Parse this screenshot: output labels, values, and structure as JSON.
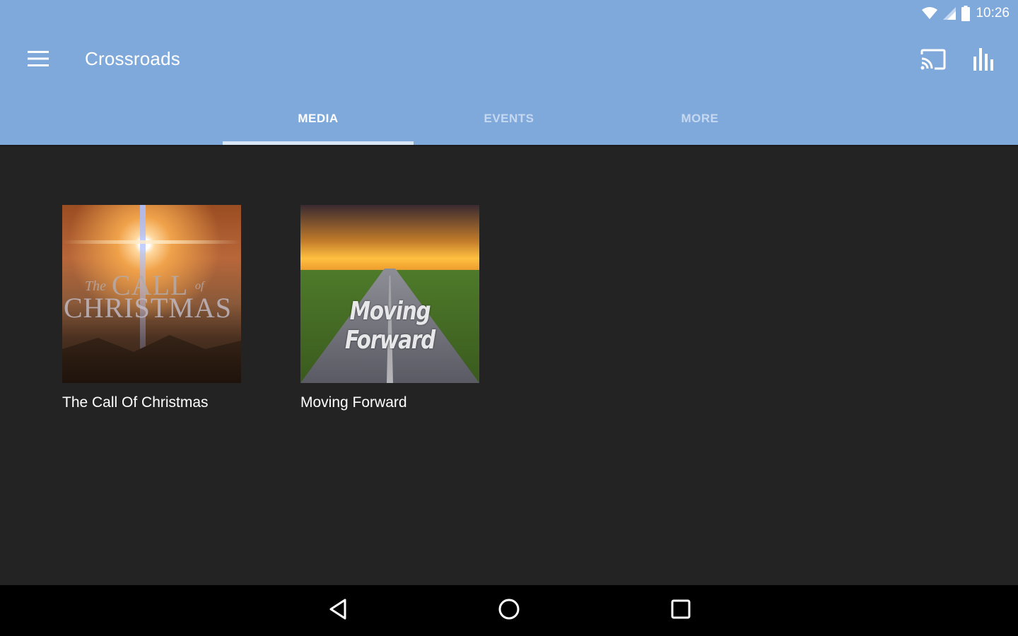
{
  "status_bar": {
    "time": "10:26",
    "icons": [
      "wifi-icon",
      "cell-signal-icon",
      "battery-icon"
    ]
  },
  "app_bar": {
    "title": "Crossroads",
    "icons": [
      "menu-icon",
      "cast-icon",
      "equalizer-icon"
    ],
    "background": "#80a9db"
  },
  "tabs": [
    {
      "label": "MEDIA",
      "active": true
    },
    {
      "label": "EVENTS",
      "active": false
    },
    {
      "label": "MORE",
      "active": false
    }
  ],
  "media": {
    "items": [
      {
        "title": "The Call Of Christmas",
        "thumb_text": {
          "the": "The",
          "call": "CALL",
          "of": "of",
          "christmas": "CHRISTMAS"
        }
      },
      {
        "title": "Moving Forward",
        "thumb_text": "Moving Forward"
      }
    ]
  },
  "nav_bar": {
    "icons": [
      "back-icon",
      "home-icon",
      "recents-icon"
    ]
  }
}
